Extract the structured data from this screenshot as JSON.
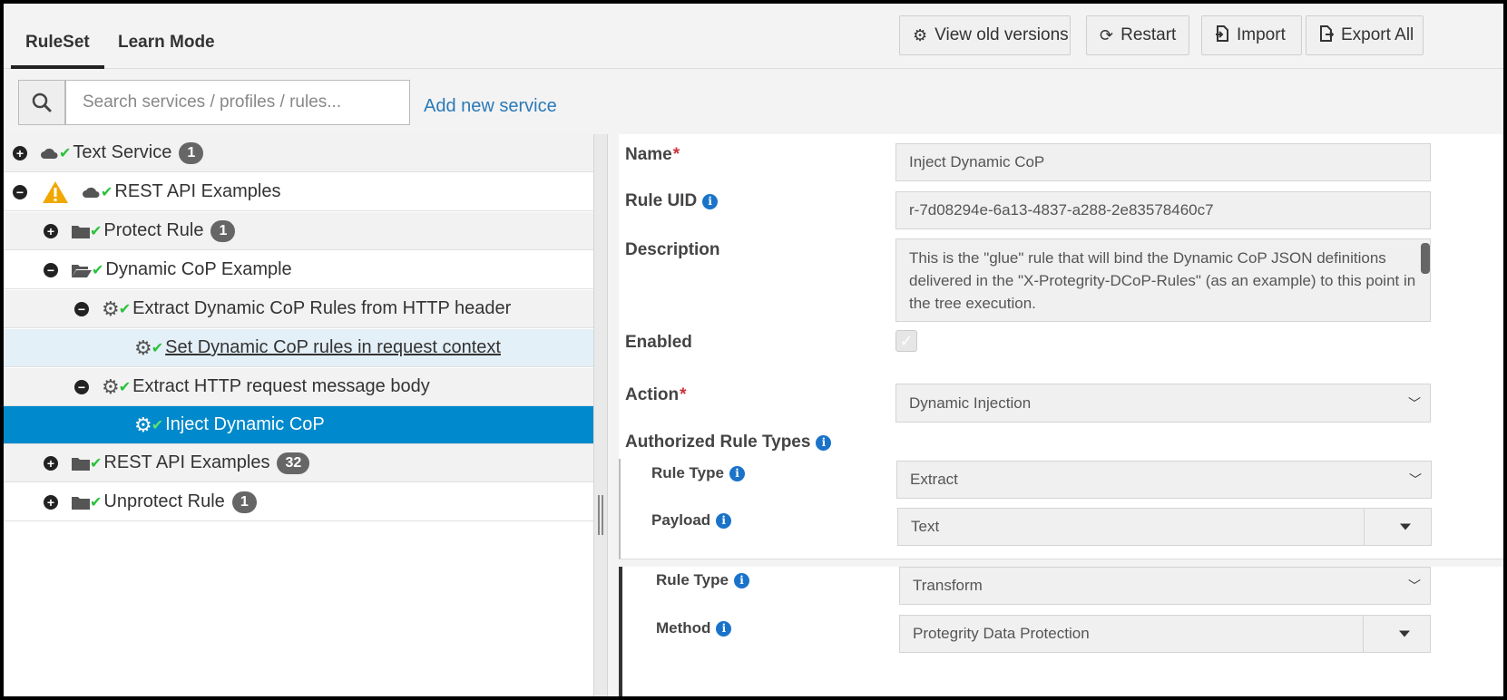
{
  "tabs": [
    {
      "label": "RuleSet",
      "active": true
    },
    {
      "label": "Learn Mode",
      "active": false
    }
  ],
  "toolbar": {
    "view_old": "View old versions",
    "restart": "Restart",
    "import": "Import",
    "export_all": "Export All"
  },
  "search": {
    "placeholder": "Search services / profiles / rules...",
    "add_service": "Add new service"
  },
  "tree": [
    {
      "label": "Text Service",
      "badge": "1",
      "type": "service",
      "expanded": false,
      "level": 0
    },
    {
      "label": "REST API Examples",
      "badge": null,
      "type": "service",
      "expanded": true,
      "warning": true,
      "level": 0
    },
    {
      "label": "Protect Rule",
      "badge": "1",
      "type": "folder",
      "expanded": false,
      "level": 1
    },
    {
      "label": "Dynamic CoP Example",
      "badge": null,
      "type": "folder",
      "expanded": true,
      "level": 1
    },
    {
      "label": "Extract Dynamic CoP Rules from HTTP header",
      "badge": null,
      "type": "rule",
      "expanded": true,
      "level": 2
    },
    {
      "label": "Set Dynamic CoP rules in request context",
      "badge": null,
      "type": "rule",
      "level": 3,
      "hovered": true
    },
    {
      "label": "Extract HTTP request message body",
      "badge": null,
      "type": "rule",
      "expanded": true,
      "level": 2
    },
    {
      "label": "Inject Dynamic CoP",
      "badge": null,
      "type": "rule",
      "level": 3,
      "selected": true
    },
    {
      "label": "REST API Examples",
      "badge": "32",
      "type": "folder",
      "expanded": false,
      "level": 1
    },
    {
      "label": "Unprotect Rule",
      "badge": "1",
      "type": "folder",
      "expanded": false,
      "level": 1
    }
  ],
  "form": {
    "name_label": "Name",
    "name_value": "Inject Dynamic CoP",
    "uid_label": "Rule UID",
    "uid_value": "r-7d08294e-6a13-4837-a288-2e83578460c7",
    "desc_label": "Description",
    "desc_value": "This is the \"glue\" rule that will bind the Dynamic CoP JSON definitions delivered in the \"X-Protegrity-DCoP-Rules\" (as an example) to this point in the tree execution.",
    "enabled_label": "Enabled",
    "enabled_checked": true,
    "action_label": "Action",
    "action_value": "Dynamic Injection",
    "auth_label": "Authorized Rule Types",
    "sub1": {
      "rule_type_label": "Rule Type",
      "rule_type_value": "Extract",
      "payload_label": "Payload",
      "payload_value": "Text"
    },
    "sub2": {
      "rule_type_label": "Rule Type",
      "rule_type_value": "Transform",
      "method_label": "Method",
      "method_value": "Protegrity Data Protection"
    }
  },
  "colors": {
    "selected_row": "#0089cc",
    "check": "#29c23a",
    "link": "#2a7ab8",
    "required": "#d0303a",
    "info": "#1a73c9"
  }
}
